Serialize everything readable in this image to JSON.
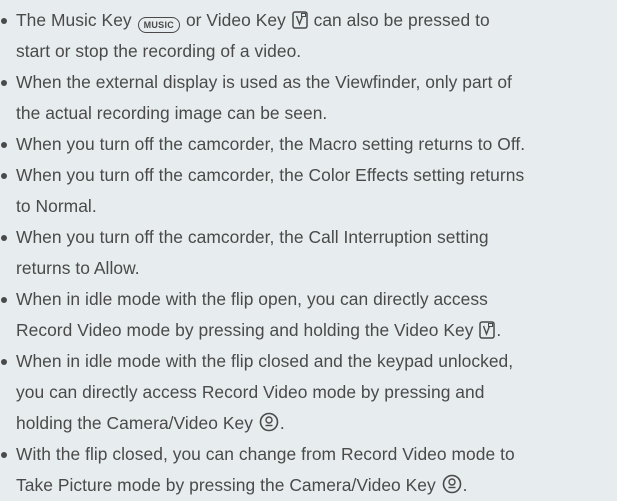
{
  "icons": {
    "music_key": "music-key-icon",
    "video_key": "video-key-icon",
    "camera_video_key": "camera-video-key-icon"
  },
  "music_key_label": "MUSIC",
  "bullets": [
    {
      "l1a": "The Music Key",
      "l1b": "or Video Key",
      "l1c": "can also be pressed to",
      "l2": "start or stop the recording of a video."
    },
    {
      "l1": "When the external display is used as the Viewfinder, only part of",
      "l2": "the actual recording image can be seen."
    },
    {
      "l1": "When you turn off the camcorder, the Macro setting returns to Off."
    },
    {
      "l1": "When you turn off the camcorder, the Color Effects setting returns",
      "l2": "to Normal."
    },
    {
      "l1": "When you turn off the camcorder, the Call Interruption setting",
      "l2": "returns to Allow."
    },
    {
      "l1": "When in idle mode with the flip open, you can directly access",
      "l2": "Record Video mode by pressing and holding the Video Key",
      "l2_end": "."
    },
    {
      "l1": "When in idle mode with the flip closed and the keypad unlocked,",
      "l2": "you can directly access Record Video mode by pressing and",
      "l3": "holding the Camera/Video Key",
      "l3_end": "."
    },
    {
      "l1": "With the flip closed, you can change from Record Video mode to",
      "l2": "Take Picture mode by pressing the Camera/Video Key",
      "l2_end": "."
    }
  ]
}
